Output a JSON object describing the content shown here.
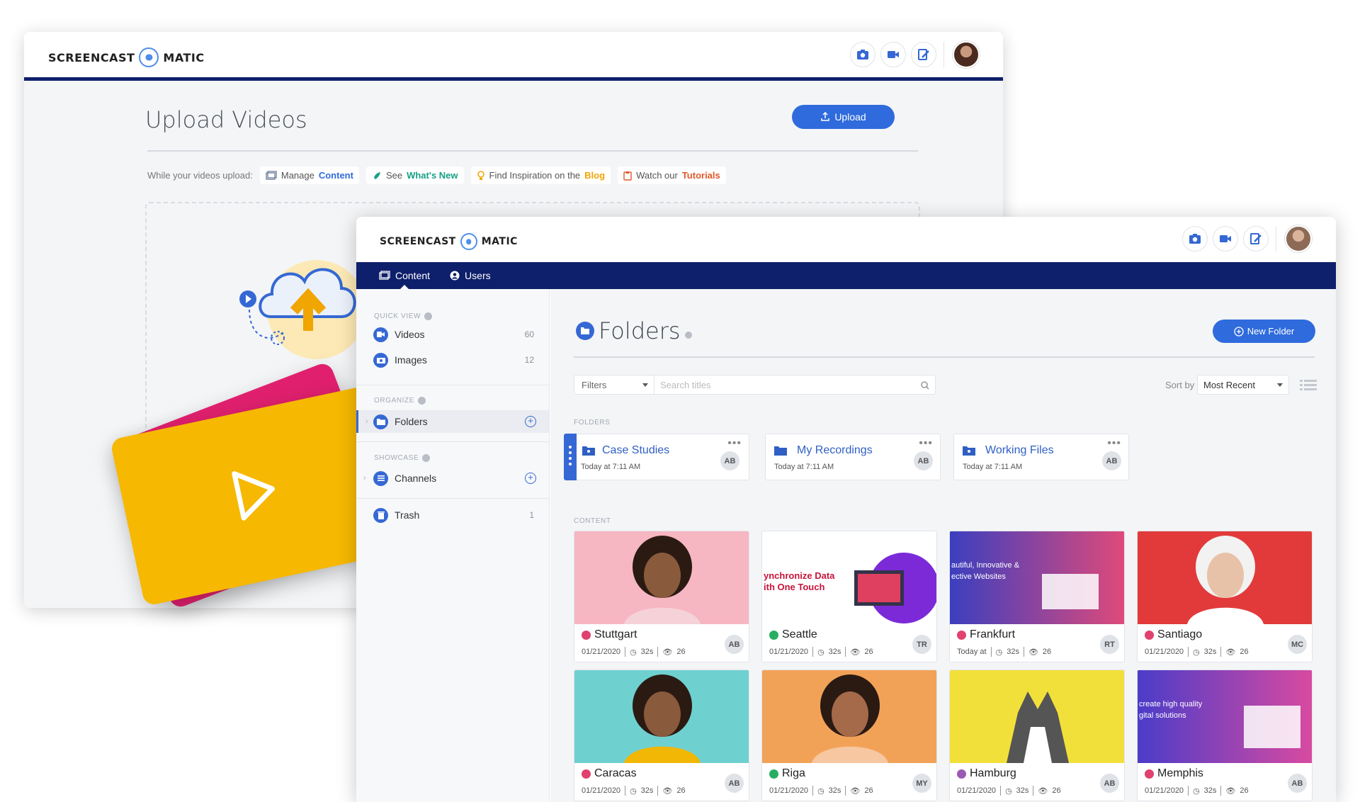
{
  "back_window": {
    "logo_left": "SCREENCAST",
    "logo_right": "MATIC",
    "title": "Upload Videos",
    "upload_button": "Upload",
    "links_intro": "While your videos upload:",
    "links": [
      {
        "prefix": "Manage",
        "highlight": "Content",
        "color": "#2f6bdc",
        "icon": "gallery-icon"
      },
      {
        "prefix": "See",
        "highlight": "What's New",
        "color": "#16a085",
        "icon": "rocket-icon"
      },
      {
        "prefix": "Find Inspiration on the",
        "highlight": "Blog",
        "color": "#f0a500",
        "icon": "lightbulb-icon"
      },
      {
        "prefix": "Watch our",
        "highlight": "Tutorials",
        "color": "#e0592a",
        "icon": "clipboard-icon"
      }
    ]
  },
  "front_window": {
    "logo_left": "SCREENCAST",
    "logo_right": "MATIC",
    "nav": {
      "content": "Content",
      "users": "Users"
    },
    "sidebar": {
      "quick_view": "QUICK VIEW",
      "videos": "Videos",
      "videos_count": "60",
      "images": "Images",
      "images_count": "12",
      "organize": "ORGANIZE",
      "folders": "Folders",
      "showcase": "SHOWCASE",
      "channels": "Channels",
      "trash": "Trash",
      "trash_count": "1"
    },
    "main": {
      "title": "Folders",
      "new_folder": "New Folder",
      "filters": "Filters",
      "search_placeholder": "Search titles",
      "sort_label": "Sort by",
      "sort_value": "Most Recent",
      "folders_heading": "FOLDERS",
      "content_heading": "CONTENT",
      "folders": [
        {
          "name": "Case Studies",
          "date": "Today at 7:11 AM",
          "initials": "AB"
        },
        {
          "name": "My Recordings",
          "date": "Today at 7:11 AM",
          "initials": "AB"
        },
        {
          "name": "Working Files",
          "date": "Today at 7:11 AM",
          "initials": "AB"
        }
      ],
      "content": [
        {
          "title": "Stuttgart",
          "date": "01/21/2020",
          "duration": "32s",
          "views": "26",
          "initials": "AB",
          "status_color": "#e0416e",
          "thumb": "#f6b6c2"
        },
        {
          "title": "Seattle",
          "date": "01/21/2020",
          "duration": "32s",
          "views": "26",
          "initials": "TR",
          "status_color": "#27ae60",
          "thumb": "#ffffff"
        },
        {
          "title": "Frankfurt",
          "date": "Today at",
          "duration": "32s",
          "views": "26",
          "initials": "RT",
          "status_color": "#e0416e",
          "thumb": "#3b3fbf"
        },
        {
          "title": "Santiago",
          "date": "01/21/2020",
          "duration": "32s",
          "views": "26",
          "initials": "MC",
          "status_color": "#e0416e",
          "thumb": "#e23a3a"
        },
        {
          "title": "Caracas",
          "date": "01/21/2020",
          "duration": "32s",
          "views": "26",
          "initials": "AB",
          "status_color": "#e0416e",
          "thumb": "#6fd0d0"
        },
        {
          "title": "Riga",
          "date": "01/21/2020",
          "duration": "32s",
          "views": "26",
          "initials": "MY",
          "status_color": "#27ae60",
          "thumb": "#f2a257"
        },
        {
          "title": "Hamburg",
          "date": "01/21/2020",
          "duration": "32s",
          "views": "26",
          "initials": "AB",
          "status_color": "#9b59b6",
          "thumb": "#f2e03a"
        },
        {
          "title": "Memphis",
          "date": "01/21/2020",
          "duration": "32s",
          "views": "26",
          "initials": "AB",
          "status_color": "#e0416e",
          "thumb": "#4b3cc9"
        }
      ],
      "thumb_texts": {
        "seattle_line1": "ynchronize Data",
        "seattle_line2": "ith One Touch",
        "frankfurt_line1": "autiful, Innovative &",
        "frankfurt_line2": "ective Websites",
        "memphis_line1": "create high quality",
        "memphis_line2": "gital solutions"
      }
    }
  }
}
